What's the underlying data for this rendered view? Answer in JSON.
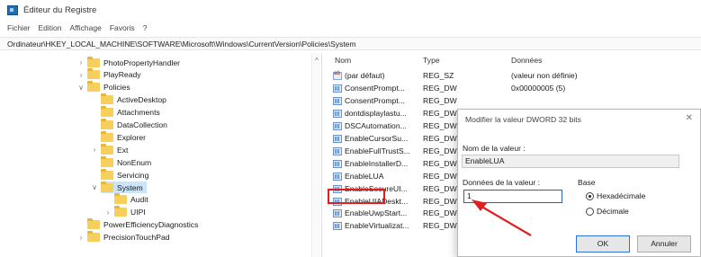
{
  "window": {
    "title": "Éditeur du Registre"
  },
  "menu": [
    "Fichier",
    "Edition",
    "Affichage",
    "Favoris",
    "?"
  ],
  "address": "Ordinateur\\HKEY_LOCAL_MACHINE\\SOFTWARE\\Microsoft\\Windows\\CurrentVersion\\Policies\\System",
  "tree": [
    {
      "label": "PhotoPropertyHandler",
      "chevron": ">"
    },
    {
      "label": "PlayReady",
      "chevron": ">"
    },
    {
      "label": "Policies",
      "chevron": "v"
    },
    {
      "label": "ActiveDesktop",
      "chevron": ""
    },
    {
      "label": "Attachments",
      "chevron": ""
    },
    {
      "label": "DataCollection",
      "chevron": ""
    },
    {
      "label": "Explorer",
      "chevron": ""
    },
    {
      "label": "Ext",
      "chevron": ">"
    },
    {
      "label": "NonEnum",
      "chevron": ""
    },
    {
      "label": "Servicing",
      "chevron": ""
    },
    {
      "label": "System",
      "chevron": "v"
    },
    {
      "label": "Audit",
      "chevron": ""
    },
    {
      "label": "UIPI",
      "chevron": ">"
    },
    {
      "label": "PowerEfficiencyDiagnostics",
      "chevron": ""
    },
    {
      "label": "PrecisionTouchPad",
      "chevron": ">"
    }
  ],
  "columns": {
    "name": "Nom",
    "type": "Type",
    "data": "Données"
  },
  "values": [
    {
      "name": "(par défaut)",
      "type": "REG_SZ",
      "data": "(valeur non définie)",
      "icon": "string-value-icon"
    },
    {
      "name": "ConsentPrompt...",
      "type": "REG_DWORD",
      "data": "0x00000005 (5)",
      "icon": "dword-value-icon"
    },
    {
      "name": "ConsentPrompt...",
      "type": "REG_DW",
      "data": "",
      "icon": "dword-value-icon"
    },
    {
      "name": "dontdisplaylastu...",
      "type": "REG_DW",
      "data": "",
      "icon": "dword-value-icon"
    },
    {
      "name": "DSCAutomation...",
      "type": "REG_DW",
      "data": "",
      "icon": "dword-value-icon"
    },
    {
      "name": "EnableCursorSu...",
      "type": "REG_DW",
      "data": "",
      "icon": "dword-value-icon"
    },
    {
      "name": "EnableFullTrustS...",
      "type": "REG_DW",
      "data": "",
      "icon": "dword-value-icon"
    },
    {
      "name": "EnableInstallerD...",
      "type": "REG_DW",
      "data": "",
      "icon": "dword-value-icon"
    },
    {
      "name": "EnableLUA",
      "type": "REG_DW",
      "data": "",
      "icon": "dword-value-icon"
    },
    {
      "name": "EnableSecureUI...",
      "type": "REG_DW",
      "data": "",
      "icon": "dword-value-icon"
    },
    {
      "name": "EnableUIADeskt...",
      "type": "REG_DW",
      "data": "",
      "icon": "dword-value-icon"
    },
    {
      "name": "EnableUwpStart...",
      "type": "REG_DW",
      "data": "",
      "icon": "dword-value-icon"
    },
    {
      "name": "EnableVirtualizat...",
      "type": "REG_DW",
      "data": "",
      "icon": "dword-value-icon"
    }
  ],
  "dialog": {
    "title": "Modifier la valeur DWORD 32 bits",
    "close": "✕",
    "name_label": "Nom de la valeur :",
    "name_value": "EnableLUA",
    "data_label": "Données de la valeur :",
    "data_value": "1",
    "base_label": "Base",
    "base_hex": "Hexadécimale",
    "base_dec": "Décimale",
    "base_selected": "Hexadécimale",
    "ok": "OK",
    "cancel": "Annuler"
  },
  "colors": {
    "highlight": "#e02020",
    "selection": "#cce4f7",
    "accent": "#2b71d8"
  }
}
